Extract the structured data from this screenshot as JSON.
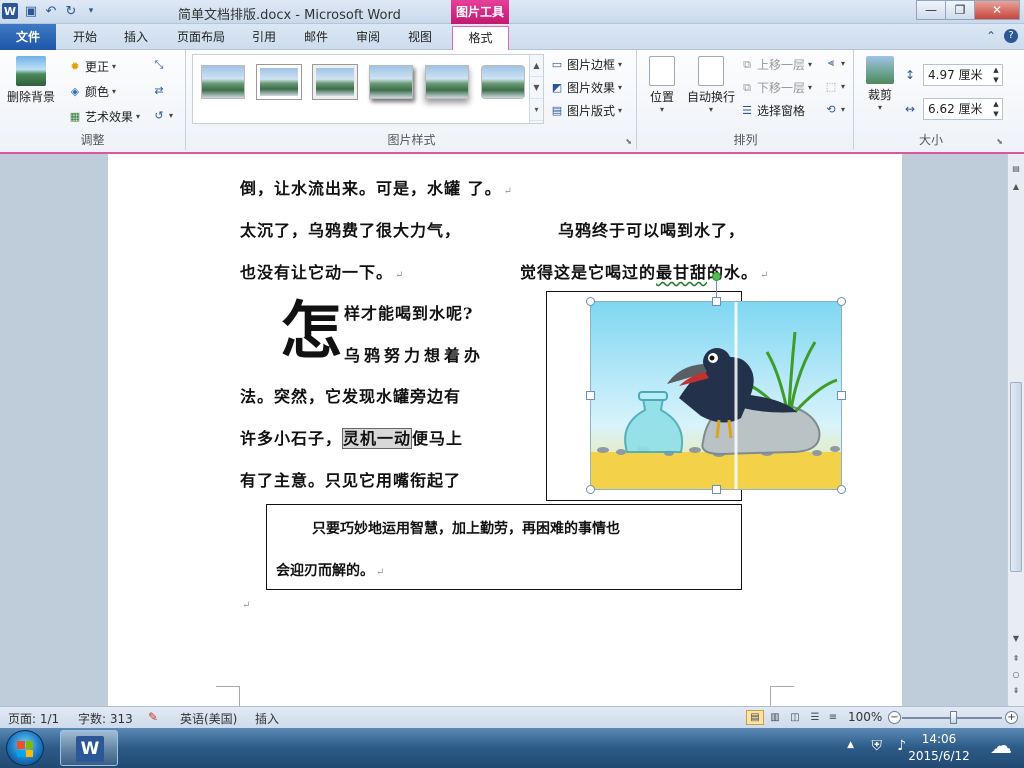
{
  "titlebar": {
    "title": "简单文档排版.docx - Microsoft Word",
    "context_group": "图片工具",
    "app_logo": "W",
    "minimize": "—",
    "maximize": "❐",
    "close": "✕"
  },
  "tabs": {
    "file": "文件",
    "items": [
      "开始",
      "插入",
      "页面布局",
      "引用",
      "邮件",
      "审阅",
      "视图"
    ],
    "active": "格式"
  },
  "ribbon": {
    "adjust": {
      "label": "调整",
      "remove_bg": "删除背景",
      "corrections": "更正",
      "color": "颜色",
      "artistic": "艺术效果"
    },
    "picture_styles": {
      "label": "图片样式",
      "border": "图片边框",
      "effects": "图片效果",
      "layout": "图片版式"
    },
    "arrange": {
      "label": "排列",
      "position": "位置",
      "wrap": "自动换行",
      "bring_forward": "上移一层",
      "send_backward": "下移一层",
      "selection_pane": "选择窗格"
    },
    "size": {
      "label": "大小",
      "crop": "裁剪",
      "height": "4.97 厘米",
      "width": "6.62 厘米"
    }
  },
  "document": {
    "line1": "倒，让水流出来。可是，水罐   了。",
    "line2a": "太沉了，乌鸦费了很大力气，",
    "line2b": "乌鸦终于可以喝到水了，",
    "line3a": "也没有让它动一下。",
    "line3b_pre": "觉得这是它喝过的",
    "line3b_wavy": "最甘甜",
    "line3b_post": "的水。",
    "dropcap": "怎",
    "line4": "样才能喝到水呢?",
    "line5": "乌鸦努力想着办",
    "line6": "法。突然，它发现水罐旁边有",
    "line7_pre": "许多小石子，",
    "line7_hl": "灵机一动",
    "line7_post": "便马上",
    "line8": "有了主意。只见它用嘴衔起了",
    "quote_line1": "只要巧妙地运用智慧，加上勤劳，再困难的事情也",
    "quote_line2": "会迎刃而解的。",
    "para_mark": "↵"
  },
  "statusbar": {
    "page": "页面: 1/1",
    "words": "字数: 313",
    "language": "英语(美国)",
    "mode": "插入",
    "zoom": "100%"
  },
  "taskbar": {
    "time": "14:06",
    "date": "2015/6/12",
    "app_letter": "W"
  }
}
